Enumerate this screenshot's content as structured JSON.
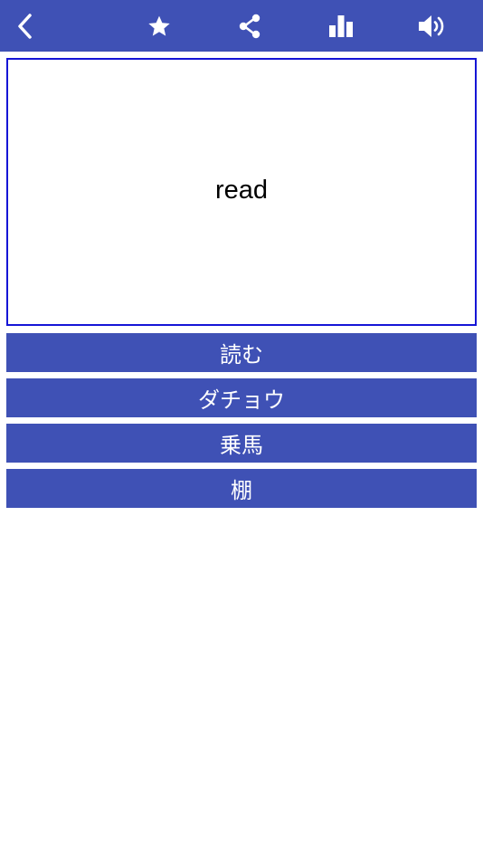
{
  "theme": {
    "primary": "#3f51b5",
    "card_border": "#1515d6"
  },
  "toolbar": {
    "icons": [
      "back-icon",
      "star-icon",
      "share-icon",
      "bar-chart-icon",
      "speaker-icon"
    ]
  },
  "card": {
    "word": "read"
  },
  "answers": [
    {
      "label": "読む"
    },
    {
      "label": "ダチョウ"
    },
    {
      "label": "乗馬"
    },
    {
      "label": "棚"
    }
  ]
}
